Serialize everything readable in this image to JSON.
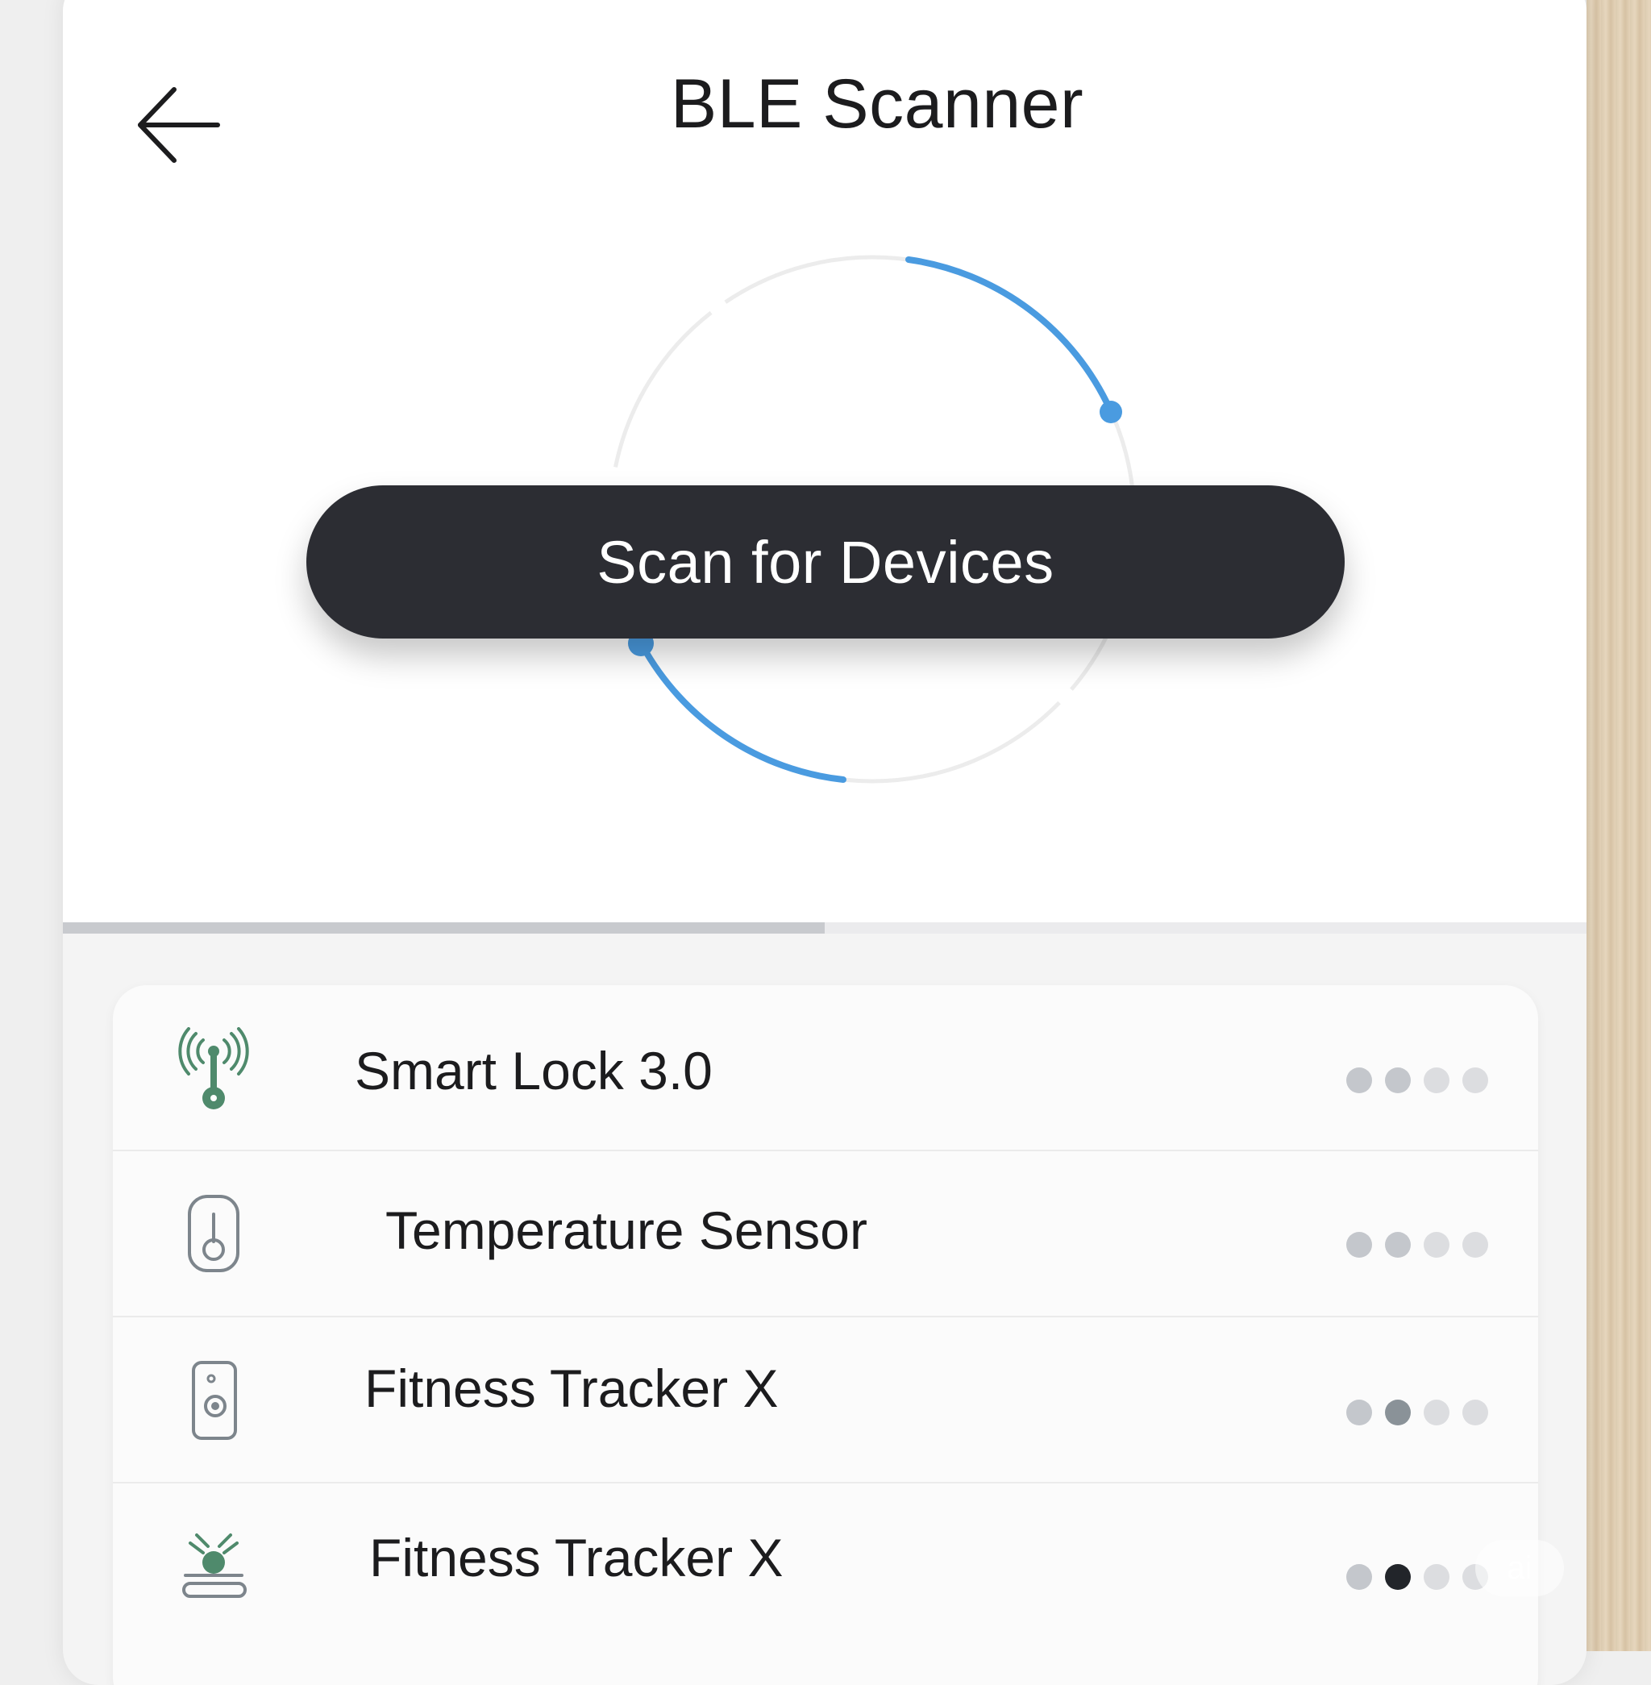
{
  "header": {
    "title": "BLE Scanner"
  },
  "scan": {
    "button_label": "Scan for Devices",
    "progress": 0.5
  },
  "colors": {
    "accent": "#4a9be0",
    "button_bg": "#2c2d33",
    "icon_green": "#4f8a6c",
    "icon_gray": "#7d858c"
  },
  "devices": [
    {
      "name": "Smart Lock 3.0",
      "icon": "antenna-lock-icon",
      "signal": [
        "#c4c7cc",
        "#c4c7cc",
        "#dcdde0",
        "#dcdde0"
      ]
    },
    {
      "name": "Temperature Sensor",
      "icon": "thermometer-icon",
      "signal": [
        "#c4c7cc",
        "#c4c7cc",
        "#dcdde0",
        "#dcdde0"
      ]
    },
    {
      "name": "Fitness Tracker X",
      "icon": "fitness-band-icon",
      "signal": [
        "#c4c7cc",
        "#8a9298",
        "#dcdde0",
        "#dcdde0"
      ]
    },
    {
      "name": "Fitness Tracker X",
      "icon": "beacon-icon",
      "signal": [
        "#c4c7cc",
        "#22252a",
        "#dcdde0",
        "#dcdde0"
      ]
    }
  ],
  "watermark": {
    "text": "ai"
  }
}
